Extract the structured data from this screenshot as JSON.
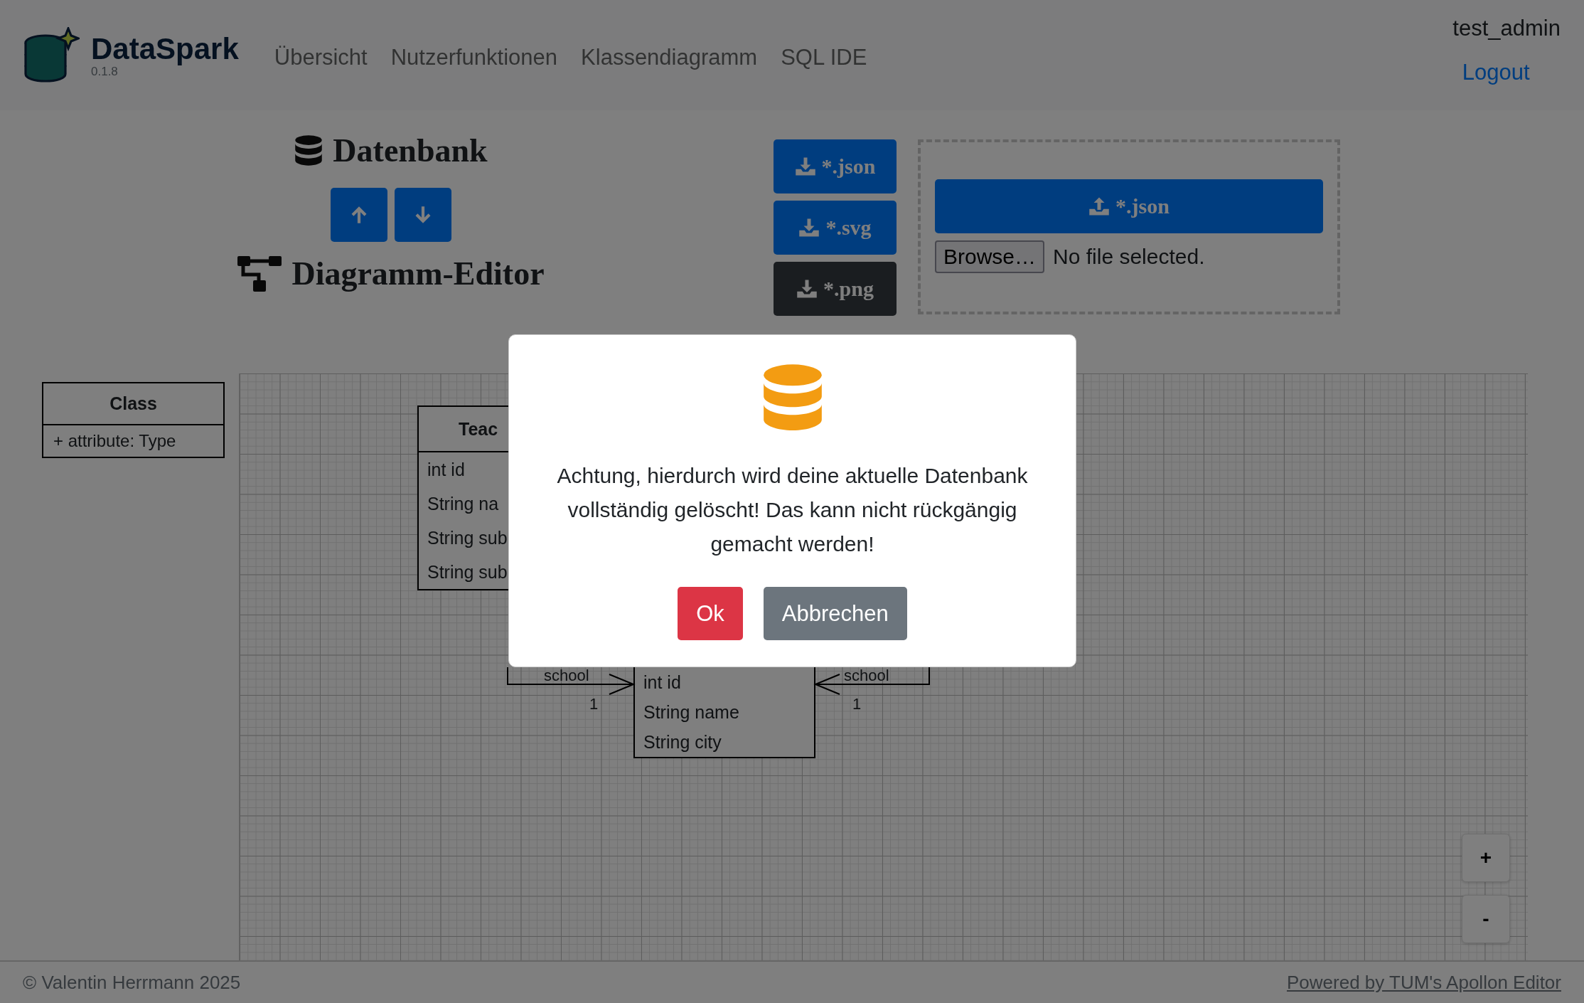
{
  "header": {
    "brand": "DataSpark",
    "version": "0.1.8",
    "nav": [
      {
        "label": "Übersicht"
      },
      {
        "label": "Nutzerfunktionen"
      },
      {
        "label": "Klassendiagramm"
      },
      {
        "label": "SQL IDE"
      }
    ],
    "user": "test_admin",
    "logout": "Logout"
  },
  "database": {
    "title": "Datenbank",
    "editor_title": "Diagramm-Editor"
  },
  "export_buttons": [
    {
      "label": "*.json",
      "kind": "primary"
    },
    {
      "label": "*.svg",
      "kind": "primary"
    },
    {
      "label": "*.png",
      "kind": "dark"
    }
  ],
  "import": {
    "button": "*.json",
    "browse": "Browse…",
    "file_status": "No file selected."
  },
  "palette": {
    "class_name": "Class",
    "attribute": "+ attribute: Type"
  },
  "diagram": {
    "classes": [
      {
        "name": "Teac",
        "attributes": [
          "int id",
          "String na",
          "String sub",
          "String sub"
        ]
      },
      {
        "attributes": [
          "int id",
          "String name",
          "String city"
        ]
      }
    ],
    "associations": [
      {
        "role": "school",
        "multiplicity": "1"
      },
      {
        "role": "school",
        "multiplicity": "1"
      }
    ]
  },
  "zoom": [
    "+",
    "-"
  ],
  "dialog": {
    "message": "Achtung, hierdurch wird deine aktuelle Datenbank vollständig gelöscht! Das kann nicht rückgängig gemacht werden!",
    "buttons": [
      {
        "label": "Ok",
        "kind": "danger"
      },
      {
        "label": "Abbrechen",
        "kind": "secondary"
      }
    ]
  },
  "footer": {
    "copyright": "© Valentin Herrmann 2025",
    "link": "Powered by TUM's Apollon Editor"
  }
}
